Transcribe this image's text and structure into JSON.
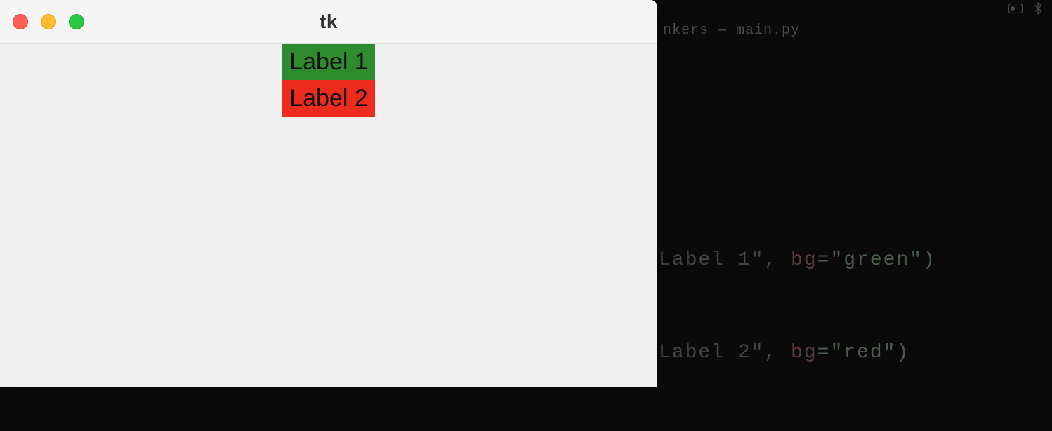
{
  "window": {
    "title": "tk"
  },
  "labels": {
    "label1": "Label 1",
    "label2": "Label 2"
  },
  "editor": {
    "tab_title": "nkers — main.py",
    "line1_text_fragment": "Label 1\", ",
    "line1_kwarg_name": "bg",
    "line1_kwarg_value": "=\"green\")",
    "line2_text_fragment": "Label 2\", ",
    "line2_kwarg_name": "bg",
    "line2_kwarg_value": "=\"red\")"
  }
}
